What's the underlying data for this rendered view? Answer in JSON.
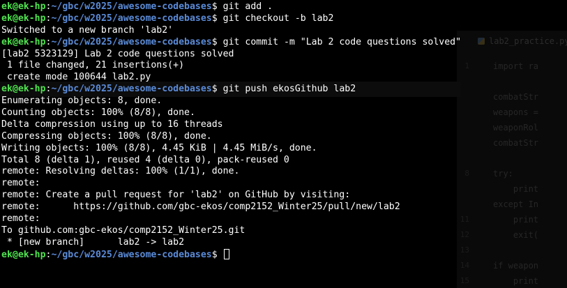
{
  "terminal": {
    "lines": [
      {
        "type": "prompt",
        "user": "ek@ek-hp",
        "path": "~/gbc/w2025/awesome-codebases",
        "symbol": "$",
        "command": " git add ."
      },
      {
        "type": "prompt",
        "user": "ek@ek-hp",
        "path": "~/gbc/w2025/awesome-codebases",
        "symbol": "$",
        "command": " git checkout -b lab2"
      },
      {
        "type": "output",
        "text": "Switched to a new branch 'lab2'"
      },
      {
        "type": "prompt",
        "user": "ek@ek-hp",
        "path": "~/gbc/w2025/awesome-codebases",
        "symbol": "$",
        "command": " git commit -m \"Lab 2 code questions solved\""
      },
      {
        "type": "output",
        "text": "[lab2 5323129] Lab 2 code questions solved"
      },
      {
        "type": "output",
        "text": " 1 file changed, 21 insertions(+)"
      },
      {
        "type": "output",
        "text": " create mode 100644 lab2.py"
      },
      {
        "type": "prompt",
        "user": "ek@ek-hp",
        "path": "~/gbc/w2025/awesome-codebases",
        "symbol": "$",
        "command": " git push ekosGithub lab2"
      },
      {
        "type": "output",
        "text": "Enumerating objects: 8, done."
      },
      {
        "type": "output",
        "text": "Counting objects: 100% (8/8), done."
      },
      {
        "type": "output",
        "text": "Delta compression using up to 16 threads"
      },
      {
        "type": "output",
        "text": "Compressing objects: 100% (8/8), done."
      },
      {
        "type": "output",
        "text": "Writing objects: 100% (8/8), 4.45 KiB | 4.45 MiB/s, done."
      },
      {
        "type": "output",
        "text": "Total 8 (delta 1), reused 4 (delta 0), pack-reused 0"
      },
      {
        "type": "output",
        "text": "remote: Resolving deltas: 100% (1/1), done."
      },
      {
        "type": "output",
        "text": "remote:"
      },
      {
        "type": "output",
        "text": "remote: Create a pull request for 'lab2' on GitHub by visiting:"
      },
      {
        "type": "output",
        "text": "remote:      https://github.com/gbc-ekos/comp2152_Winter25/pull/new/lab2"
      },
      {
        "type": "output",
        "text": "remote:"
      },
      {
        "type": "output",
        "text": "To github.com:gbc-ekos/comp2152_Winter25.git"
      },
      {
        "type": "output",
        "text": " * [new branch]      lab2 -> lab2"
      },
      {
        "type": "prompt",
        "user": "ek@ek-hp",
        "path": "~/gbc/w2025/awesome-codebases",
        "symbol": "$",
        "command": " ",
        "cursor": true
      }
    ]
  },
  "editor": {
    "tab_label": "lab2_practice.py",
    "tab_icon": "python-file-icon",
    "lines": [
      {
        "num": "1",
        "code": "import ra"
      },
      {
        "num": "",
        "code": ""
      },
      {
        "num": "",
        "code": "combatStr"
      },
      {
        "num": "",
        "code": "weapons ="
      },
      {
        "num": "",
        "code": "weaponRol"
      },
      {
        "num": "",
        "code": "combatStr"
      },
      {
        "num": "",
        "code": ""
      },
      {
        "num": "8",
        "code": "try:"
      },
      {
        "num": "",
        "code": "    print"
      },
      {
        "num": "",
        "code": "except In"
      },
      {
        "num": "11",
        "code": "    print"
      },
      {
        "num": "12",
        "code": "    exit("
      },
      {
        "num": "13",
        "code": ""
      },
      {
        "num": "14",
        "code": "if weapon"
      },
      {
        "num": "15",
        "code": "    print"
      }
    ]
  }
}
